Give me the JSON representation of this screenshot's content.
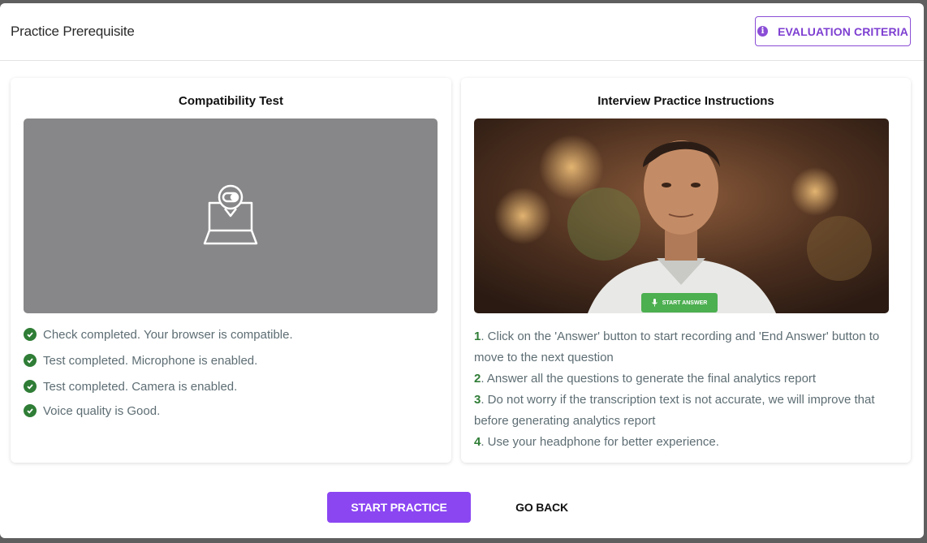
{
  "header": {
    "title": "Practice Prerequisite",
    "criteria_label": "EVALUATION CRITERIA",
    "criteria_icon": "info-icon"
  },
  "compatibility": {
    "title": "Compatibility Test",
    "camera_icon": "webcam-laptop-icon",
    "checks": [
      "Check completed. Your browser is compatible.",
      "Test completed. Microphone is enabled.",
      "Test completed. Camera is enabled.",
      "Voice quality is Good."
    ]
  },
  "instructions": {
    "title": "Interview Practice Instructions",
    "preview_button": "START ANSWER",
    "items": [
      {
        "num": "1",
        "text": ". Click on the 'Answer' button to start recording and 'End Answer' button to move to the next question"
      },
      {
        "num": "2",
        "text": ". Answer all the questions to generate the final analytics report"
      },
      {
        "num": "3",
        "text": ". Do not worry if the transcription text is not accurate, we will improve that before generating analytics report"
      },
      {
        "num": "4",
        "text": ". Use your headphone for better experience."
      }
    ]
  },
  "footer": {
    "start_label": "START PRACTICE",
    "back_label": "GO BACK"
  },
  "colors": {
    "accent": "#8b46f2",
    "success": "#2f7d36",
    "camera_bg": "#878789"
  }
}
